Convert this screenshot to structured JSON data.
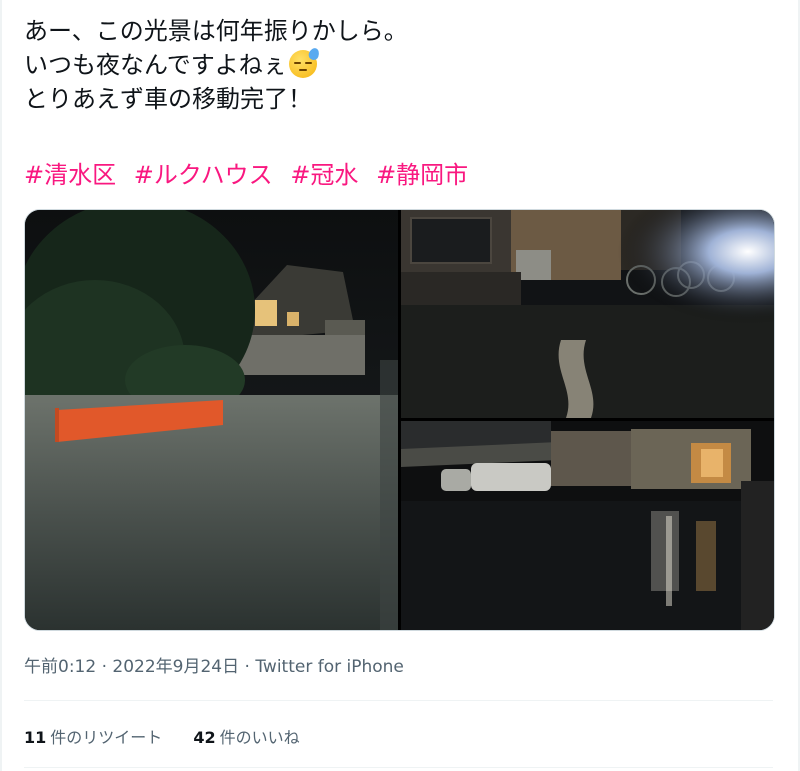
{
  "tweet": {
    "lines": [
      "あー、この光景は何年振りかしら。",
      "いつも夜なんですよねぇ",
      "とりあえず車の移動完了！"
    ],
    "emoji": "downcast-face-with-sweat",
    "hashtags": [
      "#清水区",
      "#ルクハウス",
      "#冠水",
      "#静岡市"
    ],
    "hashtag_color": "#f91880"
  },
  "media": [
    {
      "id": "flooded-street-house"
    },
    {
      "id": "flooded-alley-bicycles"
    },
    {
      "id": "flooded-carport"
    }
  ],
  "meta": {
    "time": "午前0:12",
    "date": "2022年9月24日",
    "source": "Twitter for iPhone",
    "separator": "·"
  },
  "stats": {
    "retweets_count": "11",
    "retweets_label": "件のリツイート",
    "likes_count": "42",
    "likes_label": "件のいいね"
  }
}
